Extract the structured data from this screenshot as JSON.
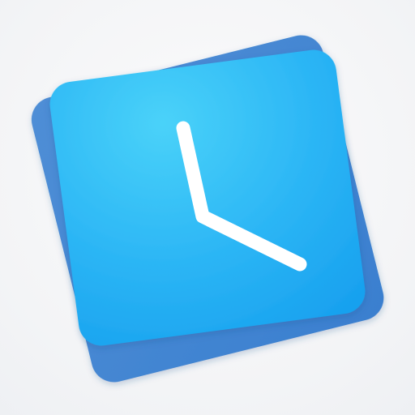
{
  "icon": {
    "name": "clock-app-icon",
    "symbol": "clock-icon",
    "colors": {
      "background": "#f4f5f7",
      "back_card": "#3f86d3",
      "front_card_top": "#48cff8",
      "front_card_bottom": "#1da7f2",
      "hands": "#ffffff"
    }
  }
}
